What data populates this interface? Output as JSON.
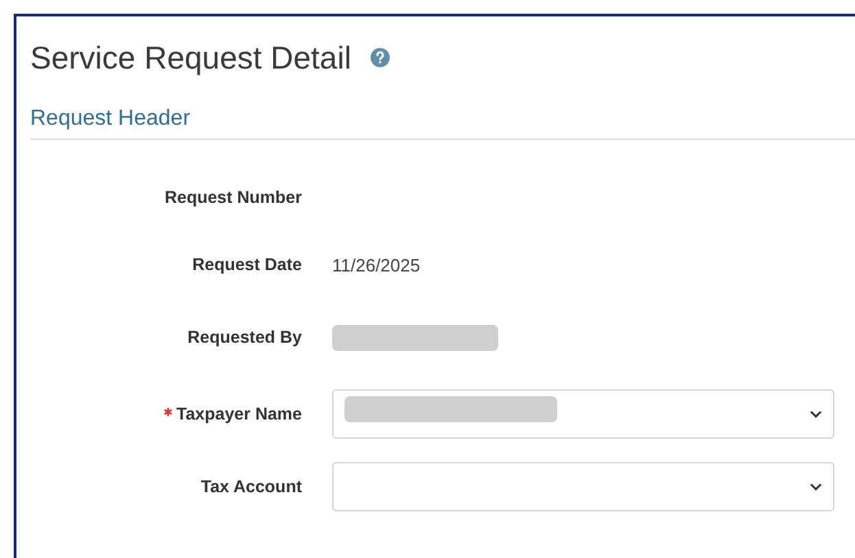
{
  "page": {
    "title": "Service Request Detail"
  },
  "section": {
    "title": "Request Header"
  },
  "fields": [
    {
      "label": "Request Number",
      "kind": "text",
      "redacted": false,
      "required": false
    },
    {
      "label": "Request Date",
      "kind": "text",
      "value": "11/26/2025",
      "redacted": false,
      "required": false
    },
    {
      "label": "Requested By",
      "kind": "text",
      "redacted": true,
      "required": false
    },
    {
      "label": "Taxpayer Name",
      "kind": "select",
      "redacted": true,
      "required": true
    },
    {
      "label": "Tax Account",
      "kind": "select",
      "redacted": false,
      "required": false
    }
  ]
}
